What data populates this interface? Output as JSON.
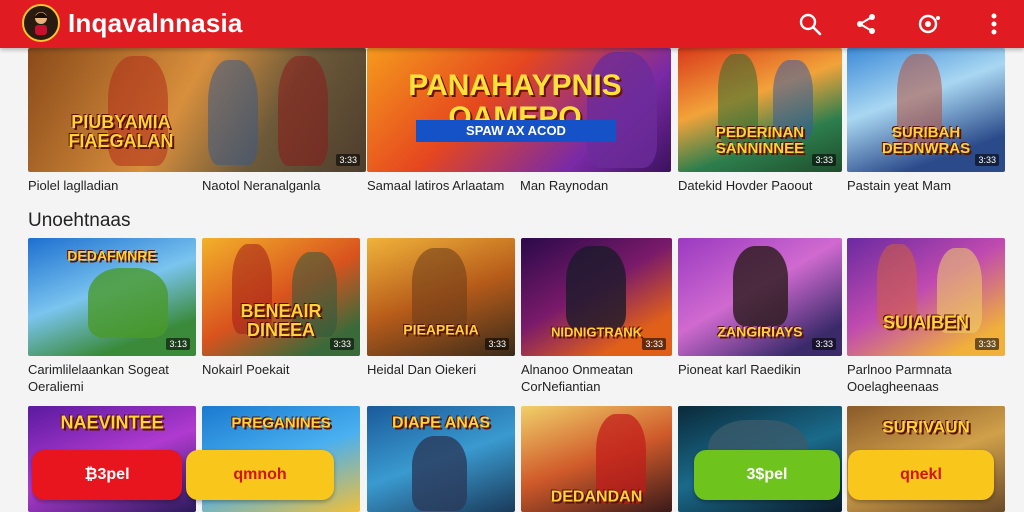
{
  "header": {
    "app_title": "Inqavalnnasia",
    "logo_icon": "mascot-logo-icon",
    "icons": [
      "search-icon",
      "share-icon",
      "settings-icon",
      "more-vert-icon"
    ],
    "color": "#e01b22"
  },
  "top_row": {
    "cards": [
      {
        "title": "Piolel laglladian",
        "badge": "3:33",
        "art": "PIUBYAMIA FIAEGALAN"
      },
      {
        "title": "Naotol Neranalganla",
        "badge": "",
        "art": ""
      },
      {
        "title": "Samaal latiros Arlaatam",
        "badge": "",
        "art": ""
      },
      {
        "title": "Man Raynodan",
        "badge": "",
        "art": ""
      },
      {
        "title": "Datekid Hovder Paoout",
        "badge": "3:33",
        "art": "PEDERINAN SANNINNEE"
      },
      {
        "title": "Pastain yeat Mam",
        "badge": "3:33",
        "art": "SURIBAH DEDNWRAS"
      }
    ],
    "banner": {
      "title": "PANAHAYPNIS OAMEPO",
      "button": "SPAW AX ACOD"
    }
  },
  "section": {
    "title": "Unoehtnaas"
  },
  "grid_row": {
    "cards": [
      {
        "title": "Carimlilelaankan Sogeat",
        "subtitle": "Oeraliemi",
        "badge": "3:13",
        "art": "DEDAFMNRE"
      },
      {
        "title": "Nokairl Poekait",
        "subtitle": "",
        "badge": "3:33",
        "art": "BENEAIR DINEEA"
      },
      {
        "title": "Heidal Dan Oiekeri",
        "subtitle": "",
        "badge": "3:33",
        "art": "PIEAPEAIA"
      },
      {
        "title": "Alnanoo Onmeatan",
        "subtitle": "CorNefiantian",
        "badge": "3:33",
        "art": "NIDNIGTRANK"
      },
      {
        "title": "Pioneat karl Raedikin",
        "subtitle": "",
        "badge": "3:33",
        "art": "ZANGIRIAYS"
      },
      {
        "title": "Parlnoo Parmnata",
        "subtitle": "Ooelagheenaas",
        "badge": "3:33",
        "art": "SUIAIBEN"
      }
    ]
  },
  "bottom_row": {
    "cards": [
      {
        "art": "NAEVINTEE"
      },
      {
        "art": "PREGANINES"
      },
      {
        "art": "DIAPE ANAS"
      },
      {
        "art": "DEDANDAN"
      },
      {
        "art": ""
      },
      {
        "art": "SURIVAUN"
      }
    ]
  },
  "pills": {
    "left_red": "₿3pel",
    "left_yellow": "qmnoh",
    "right_green": "3$pel",
    "right_yellow": "qnekl"
  }
}
